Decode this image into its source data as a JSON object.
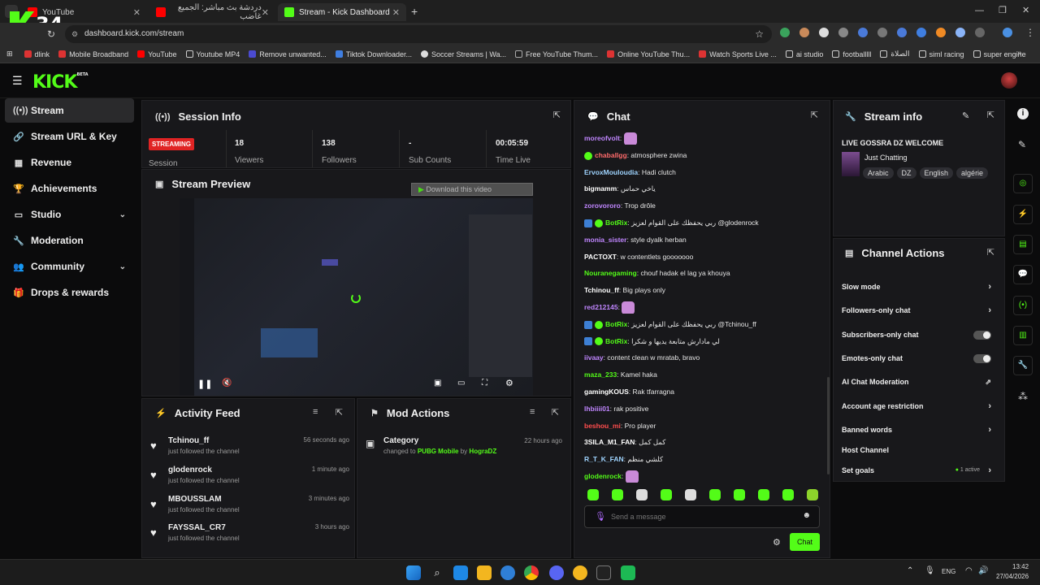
{
  "browser": {
    "tabs": [
      {
        "title": "YouTube",
        "fav": "youtube-icon"
      },
      {
        "title": "دردشة بث مباشر: الجميع غاضب",
        "fav": "youtube-icon"
      },
      {
        "title": "Stream - Kick Dashboard",
        "fav": "kick-icon"
      }
    ],
    "url": "dashboard.kick.com/stream",
    "overlay_logo": "34",
    "bookmarks": [
      "dlink",
      "Mobile Broadband",
      "YouTube",
      "Youtube MP4",
      "Remove unwanted...",
      "Tiktok Downloader...",
      "Soccer Streams | Wa...",
      "Free YouTube Thum...",
      "Online YouTube Thu...",
      "Watch Sports Live ...",
      "ai studio",
      "footballlll",
      "الصلاة",
      "siml racing",
      "super engine"
    ]
  },
  "header": {
    "logo": "KICK",
    "logo_tag": "BETA"
  },
  "sidebar": {
    "items": [
      {
        "label": "Stream",
        "icon": "broadcast-icon"
      },
      {
        "label": "Stream URL & Key",
        "icon": "link-icon"
      },
      {
        "label": "Revenue",
        "icon": "chart-icon"
      },
      {
        "label": "Achievements",
        "icon": "trophy-icon"
      },
      {
        "label": "Studio",
        "icon": "studio-icon"
      },
      {
        "label": "Moderation",
        "icon": "wrench-icon"
      },
      {
        "label": "Community",
        "icon": "community-icon"
      },
      {
        "label": "Drops & rewards",
        "icon": "gift-icon"
      }
    ]
  },
  "session": {
    "title": "Session Info",
    "status": "STREAMING",
    "status_label": "Session",
    "viewers": "18",
    "viewers_label": "Viewers",
    "followers": "138",
    "followers_label": "Followers",
    "subs": "-",
    "subs_label": "Sub Counts",
    "time": "00:05:59",
    "time_label": "Time Live"
  },
  "preview": {
    "title": "Stream Preview",
    "download": "Download this video"
  },
  "activity": {
    "title": "Activity Feed",
    "items": [
      {
        "name": "Tchinou_ff",
        "sub": "just followed the channel",
        "time": "56 seconds ago"
      },
      {
        "name": "glodenrock",
        "sub": "just followed the channel",
        "time": "1 minute ago"
      },
      {
        "name": "MBOUSSLAM",
        "sub": "just followed the channel",
        "time": "3 minutes ago"
      },
      {
        "name": "FAYSSAL_CR7",
        "sub": "just followed the channel",
        "time": "3 hours ago"
      }
    ]
  },
  "mod": {
    "title": "Mod Actions",
    "category_label": "Category",
    "changed": "changed to",
    "game": "PUBG Mobile",
    "by": "by",
    "user": "HograDZ",
    "time": "22 hours ago"
  },
  "chat": {
    "title": "Chat",
    "placeholder": "Send a message",
    "send": "Chat",
    "messages": [
      {
        "user": "moreofvolt",
        "text": "",
        "color": "#c086ff"
      },
      {
        "user": "chaballgg",
        "text": "atmosphere zwina",
        "color": "#ff6b6b"
      },
      {
        "user": "ErvoxMouloudia",
        "text": "Hadi clutch",
        "color": "#9fd4ff"
      },
      {
        "user": "bigmamm",
        "text": "ياخي حماس",
        "color": "#ffffff"
      },
      {
        "user": "zorovororo",
        "text": "Trop drôle",
        "color": "#c086ff"
      },
      {
        "user": "BotRix",
        "text": "ربي يحفظك على القوام لعزيز @glodenrock",
        "color": "#53fc18"
      },
      {
        "user": "monia_sister",
        "text": "style dyalk herban",
        "color": "#c086ff"
      },
      {
        "user": "PACTOXT",
        "text": "w contentlets gooooooo",
        "color": "#ffffff"
      },
      {
        "user": "Nouranegaming",
        "text": "chouf hadak el lag ya khouya",
        "color": "#53fc18"
      },
      {
        "user": "Tchinou_ff",
        "text": "Big plays only",
        "color": "#ffffff"
      },
      {
        "user": "red212145",
        "text": "",
        "color": "#c086ff"
      },
      {
        "user": "BotRix",
        "text": "ربي يحفظك على القوام لعزيز @Tchinou_ff",
        "color": "#53fc18"
      },
      {
        "user": "BotRix",
        "text": "لي مادارش متابعة يديها و شكرا",
        "color": "#53fc18"
      },
      {
        "user": "iivaay",
        "text": "content clean w mratab, bravo",
        "color": "#c086ff"
      },
      {
        "user": "maza_233",
        "text": "Kamel haka",
        "color": "#53fc18"
      },
      {
        "user": "gamingKOUS",
        "text": "Rak tfarragna",
        "color": "#ffffff"
      },
      {
        "user": "lhbiiii01",
        "text": "rak positive",
        "color": "#c086ff"
      },
      {
        "user": "beshou_mi",
        "text": "Pro player",
        "color": "#ff4d4d"
      },
      {
        "user": "3SILA_M1_FAN",
        "text": "كمل كمل",
        "color": "#ffffff"
      },
      {
        "user": "R_T_K_FAN",
        "text": "كلشي منظم",
        "color": "#9fd4ff"
      },
      {
        "user": "glodenrock",
        "text": "",
        "color": "#53fc18"
      }
    ]
  },
  "stream_info": {
    "title": "Stream info",
    "stream_title": "LIVE GOSSRA DZ WELCOME",
    "category": "Just Chatting",
    "tags": [
      "Arabic",
      "DZ",
      "English",
      "algérie"
    ]
  },
  "channel_actions": {
    "title": "Channel Actions",
    "rows": [
      {
        "label": "Slow mode",
        "kind": "chevron"
      },
      {
        "label": "Followers-only chat",
        "kind": "chevron"
      },
      {
        "label": "Subscribers-only chat",
        "kind": "toggle"
      },
      {
        "label": "Emotes-only chat",
        "kind": "toggle"
      },
      {
        "label": "AI Chat Moderation",
        "kind": "external"
      },
      {
        "label": "Account age restriction",
        "kind": "chevron"
      },
      {
        "label": "Banned words",
        "kind": "chevron"
      },
      {
        "label": "Host Channel",
        "kind": "none"
      },
      {
        "label": "Set goals",
        "kind": "active",
        "extra": "1 active"
      }
    ]
  },
  "taskbar": {
    "lang": "ENG",
    "time": "13:42",
    "date": "27/04/2026"
  },
  "colors": {
    "accent": "#53fc18",
    "bg": "#0b0b0c",
    "panel": "#18181b",
    "streaming": "#e02424"
  }
}
